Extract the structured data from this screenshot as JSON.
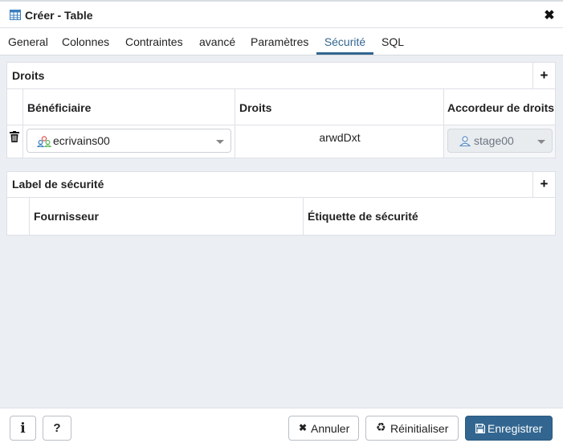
{
  "dialog": {
    "title": "Créer - Table",
    "close_icon": "close-icon"
  },
  "tabs": [
    {
      "label": "General"
    },
    {
      "label": "Colonnes"
    },
    {
      "label": "Contraintes"
    },
    {
      "label": "avancé"
    },
    {
      "label": "Paramètres"
    },
    {
      "label": "Sécurité",
      "active": true
    },
    {
      "label": "SQL"
    }
  ],
  "privileges": {
    "title": "Droits",
    "add_icon": "plus-icon",
    "columns": [
      "Bénéficiaire",
      "Droits",
      "Accordeur de droits"
    ],
    "rows": [
      {
        "grantee": "ecrivains00",
        "privileges": "arwdDxt",
        "grantor": "stage00"
      }
    ]
  },
  "security_labels": {
    "title": "Label de sécurité",
    "add_icon": "plus-icon",
    "columns": [
      "Fournisseur",
      "Étiquette de sécurité"
    ]
  },
  "footer": {
    "info_icon": "info-icon",
    "help_label": "?",
    "cancel_label": "Annuler",
    "reset_label": "Réinitialiser",
    "save_label": "Enregistrer"
  },
  "colors": {
    "accent": "#326690",
    "background": "#ebeef3"
  }
}
